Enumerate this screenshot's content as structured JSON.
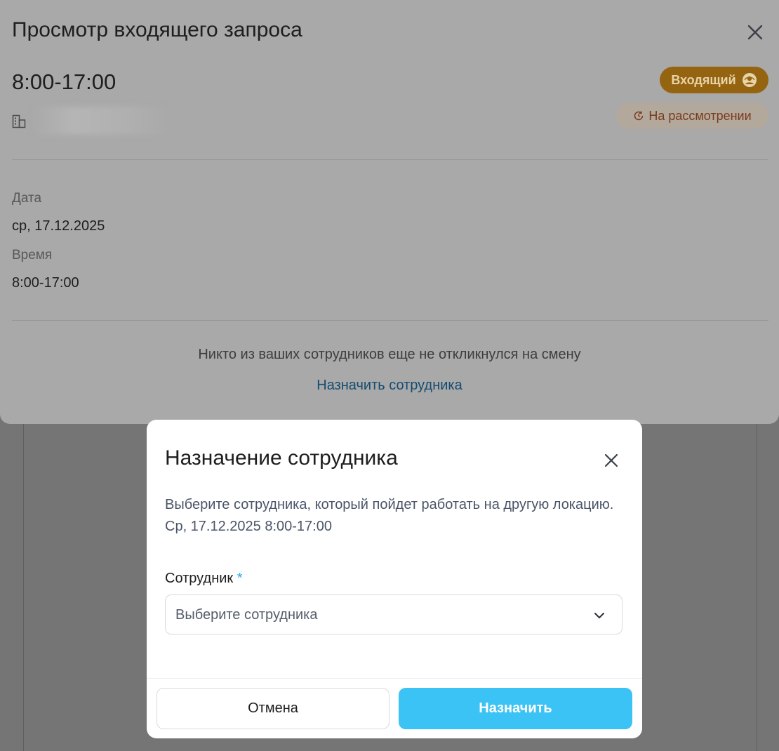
{
  "sheet": {
    "title": "Просмотр входящего запроса",
    "time_range": "8:00-17:00",
    "incoming_badge": "Входящий",
    "status_badge": "На рассмотрении",
    "date_label": "Дата",
    "date_value": "ср, 17.12.2025",
    "time_label": "Время",
    "time_value": "8:00-17:00",
    "no_response_text": "Никто из ваших сотрудников еще не откликнулся на смену",
    "assign_link": "Назначить сотрудника"
  },
  "modal": {
    "title": "Назначение сотрудника",
    "description_line1": "Выберите сотрудника, который пойдет работать на другую локацию.",
    "description_line2": "Ср, 17.12.2025 8:00-17:00",
    "employee_label": "Сотрудник",
    "required_mark": "*",
    "employee_placeholder": "Выберите сотрудника",
    "cancel_label": "Отмена",
    "assign_label": "Назначить"
  },
  "icons": [
    "close-icon",
    "building-icon",
    "support-agent-icon",
    "clock-refresh-icon",
    "chevron-down-icon"
  ],
  "colors": {
    "accent": "#3cc3f5",
    "incoming_badge_bg": "#946410",
    "status_badge_text": "#7a3a1c",
    "link": "#154c70"
  }
}
